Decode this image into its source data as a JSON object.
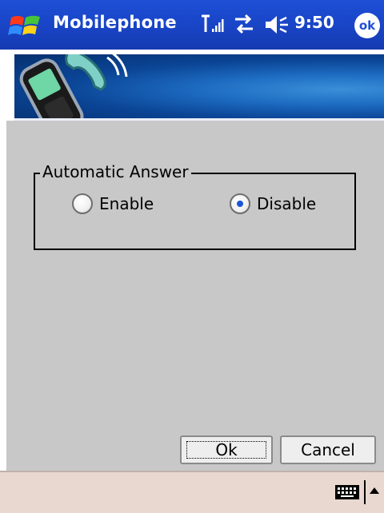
{
  "titlebar": {
    "app_title": "Mobilephone",
    "clock": "9:50",
    "ok_label": "ok",
    "icons": [
      "windows-start-icon",
      "signal-strength-icon",
      "connectivity-icon",
      "volume-icon"
    ]
  },
  "dialog": {
    "group_title": "Automatic Answer",
    "options": [
      {
        "label": "Enable",
        "selected": false
      },
      {
        "label": "Disable",
        "selected": true
      }
    ],
    "ok_button": "Ok",
    "cancel_button": "Cancel"
  },
  "menubar": {
    "icons": [
      "keyboard-icon",
      "input-menu-arrow-icon"
    ]
  },
  "colors": {
    "titlebar": "#1e4fd6",
    "content_bg": "#c8c8c8",
    "menubar_bg": "#e8d8d0",
    "radio_selected": "#1a55d6"
  }
}
